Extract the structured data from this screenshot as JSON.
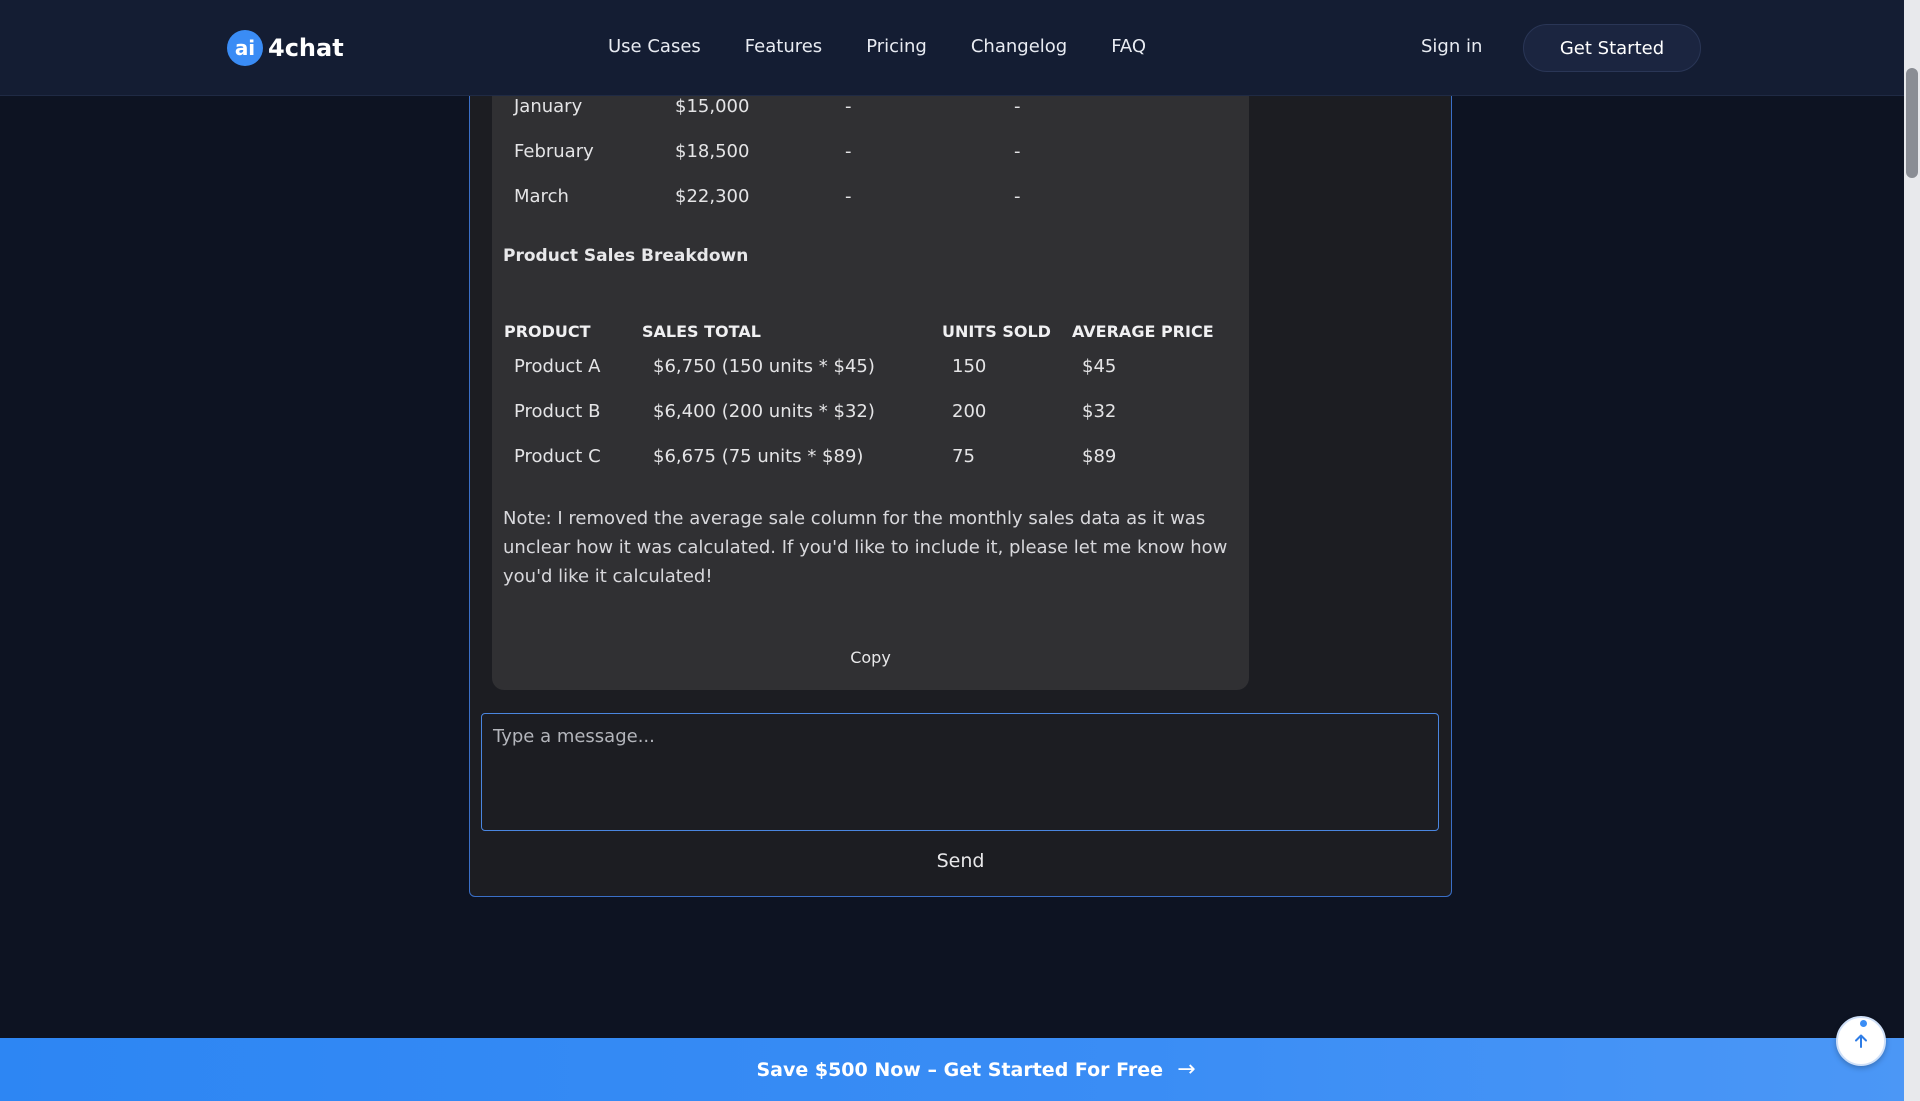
{
  "header": {
    "logo_badge": "ai",
    "logo_text": "4chat",
    "nav": [
      "Use Cases",
      "Features",
      "Pricing",
      "Changelog",
      "FAQ"
    ],
    "sign_in": "Sign in",
    "get_started": "Get Started"
  },
  "monthly_sales": [
    {
      "month": "January",
      "total": "$15,000",
      "col3": "-",
      "col4": "-"
    },
    {
      "month": "February",
      "total": "$18,500",
      "col3": "-",
      "col4": "-"
    },
    {
      "month": "March",
      "total": "$22,300",
      "col3": "-",
      "col4": "-"
    }
  ],
  "product_section": {
    "heading": "Product Sales Breakdown",
    "columns": [
      "PRODUCT",
      "SALES TOTAL",
      "UNITS SOLD",
      "AVERAGE PRICE"
    ],
    "rows": [
      {
        "product": "Product A",
        "sales_total": "$6,750 (150 units * $45)",
        "units": "150",
        "avg_price": "$45"
      },
      {
        "product": "Product B",
        "sales_total": "$6,400 (200 units * $32)",
        "units": "200",
        "avg_price": "$32"
      },
      {
        "product": "Product C",
        "sales_total": "$6,675 (75 units * $89)",
        "units": "75",
        "avg_price": "$89"
      }
    ]
  },
  "note": "Note: I removed the average sale column for the monthly sales data as it was unclear how it was calculated. If you'd like to include it, please let me know how you'd like it calculated!",
  "copy_label": "Copy",
  "composer": {
    "placeholder": "Type a message...",
    "value": "",
    "send_label": "Send"
  },
  "banner": {
    "text": "Save $500 Now – Get Started For Free",
    "arrow": "→"
  },
  "icons": {
    "scroll_top": "arrow-up-icon"
  },
  "colors": {
    "accent": "#3a8cf5",
    "page_bg": "#0d1322",
    "nav_bg": "#141d33",
    "card_bg": "#303033"
  }
}
